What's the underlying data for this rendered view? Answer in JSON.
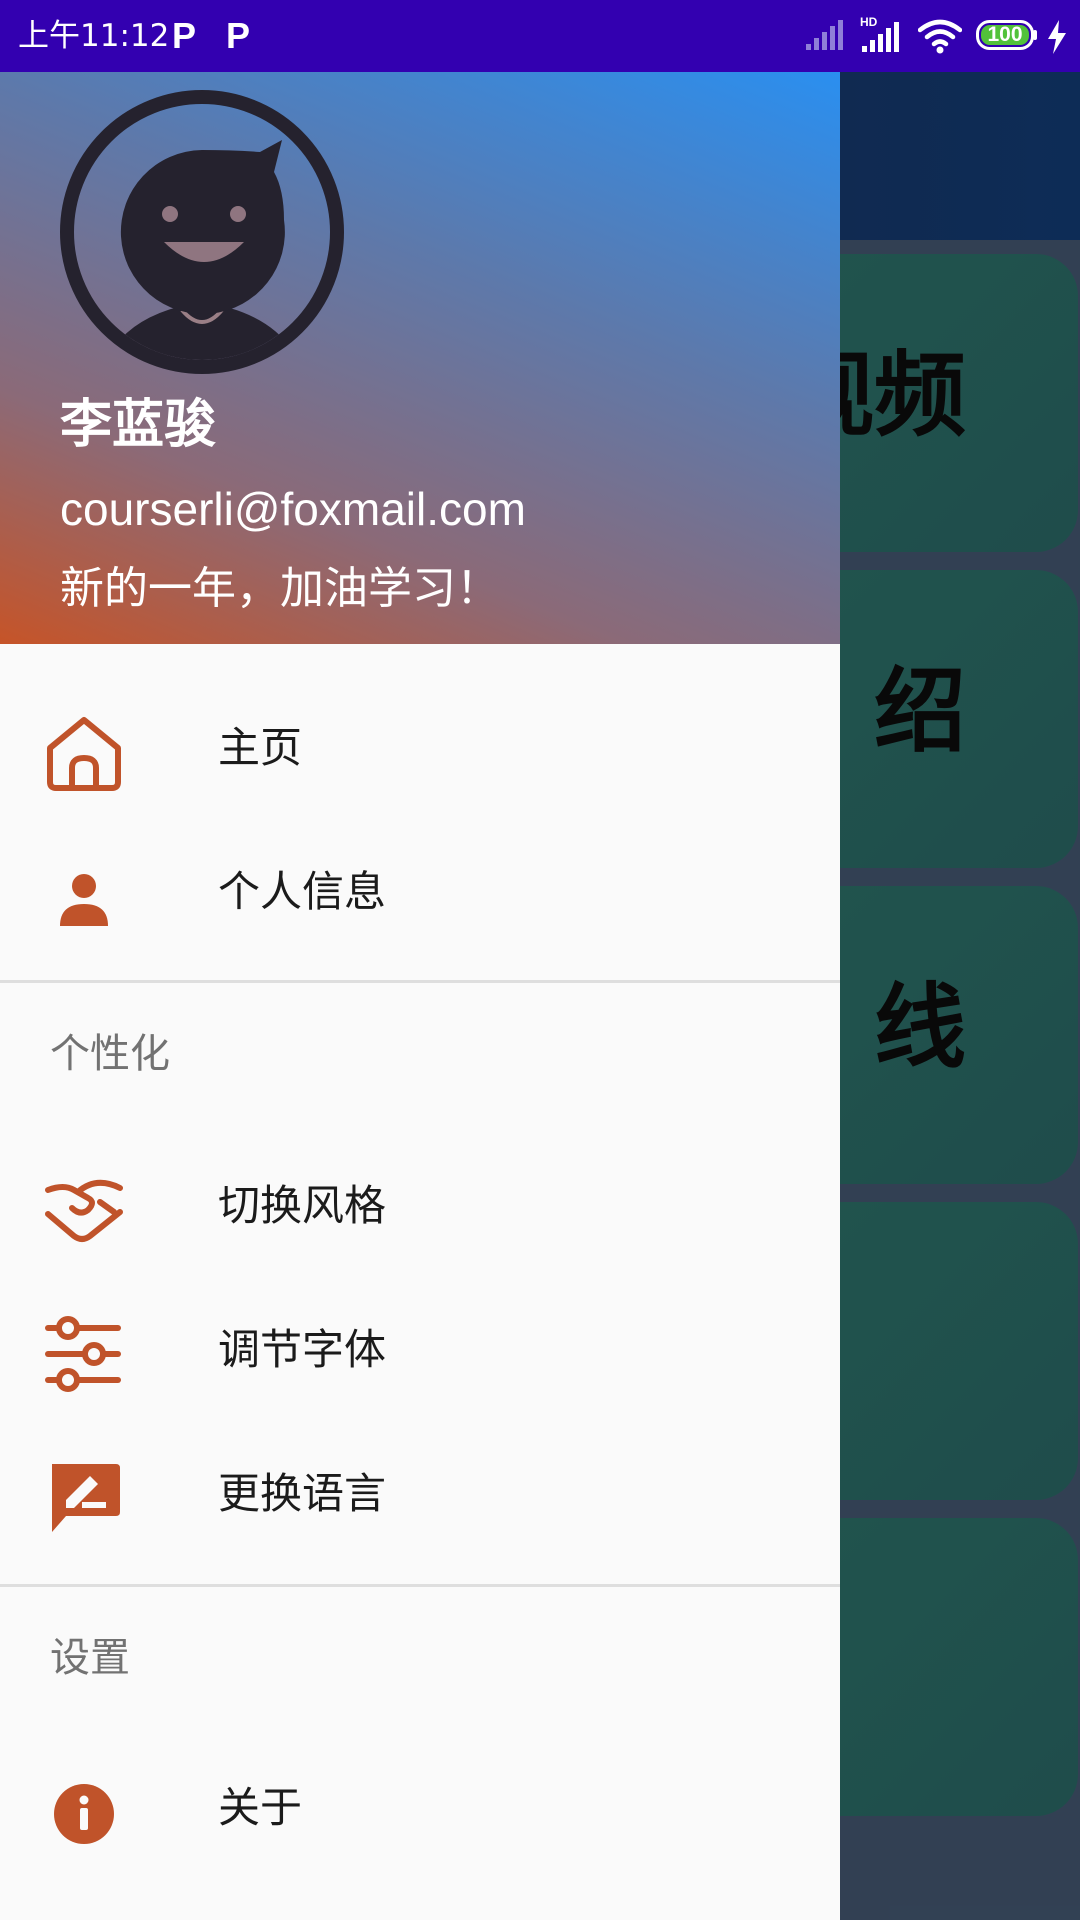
{
  "status_bar": {
    "time": "上午11:12",
    "p_icon": "P",
    "battery": "100",
    "icons": [
      "p-notification-icon",
      "signal-icon",
      "hd-signal-icon",
      "wifi-icon",
      "battery-icon",
      "charging-icon"
    ]
  },
  "background_cards": [
    {
      "text": "视频"
    },
    {
      "text": "绍"
    },
    {
      "text": "线"
    },
    {
      "text": ""
    },
    {
      "text": ""
    }
  ],
  "drawer": {
    "header": {
      "name": "李蓝骏",
      "email": "courserli@foxmail.com",
      "motto": "新的一年，加油学习！"
    },
    "items": [
      {
        "label": "主页",
        "icon": "home-icon"
      },
      {
        "label": "个人信息",
        "icon": "person-icon"
      }
    ],
    "section_personalize": {
      "title": "个性化",
      "items": [
        {
          "label": "切换风格",
          "icon": "style-switch-icon"
        },
        {
          "label": "调节字体",
          "icon": "sliders-icon"
        },
        {
          "label": "更换语言",
          "icon": "edit-comment-icon"
        }
      ]
    },
    "section_settings": {
      "title": "设置",
      "items": [
        {
          "label": "关于",
          "icon": "info-icon"
        }
      ]
    }
  },
  "colors": {
    "status_bar": "#3300b0",
    "accent": "#c0532a",
    "drawer_bg": "#fafafa",
    "card": "#2a6a60"
  }
}
